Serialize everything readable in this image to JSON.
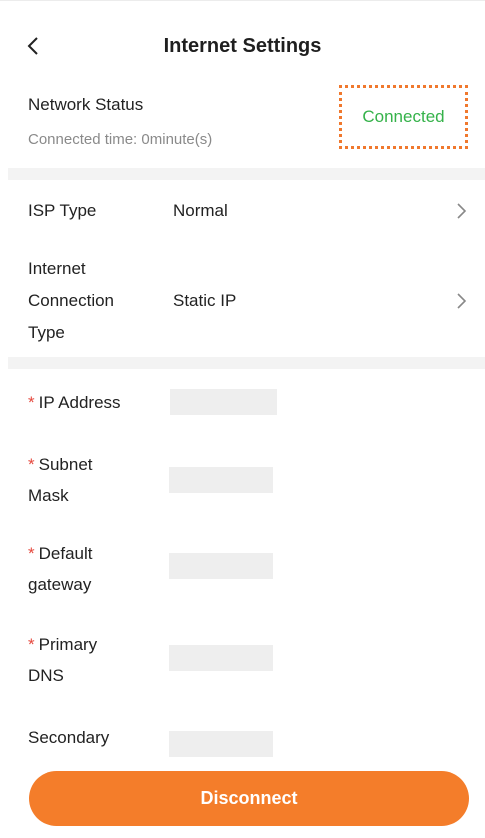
{
  "header": {
    "title": "Internet Settings",
    "back_icon": "chevron-left-icon"
  },
  "network_status": {
    "label": "Network Status",
    "connected_time": "Connected time: 0minute(s)",
    "status": "Connected",
    "status_color": "#35b24a",
    "highlight_color": "#f0782d"
  },
  "isp": {
    "label": "ISP Type",
    "value": "Normal"
  },
  "connection_type": {
    "label_lines": [
      "Internet",
      "Connection",
      "Type"
    ],
    "value": "Static IP"
  },
  "fields": {
    "ip_address": {
      "required_mark": "*",
      "label_lines": [
        "IP Address"
      ],
      "value": ""
    },
    "subnet_mask": {
      "required_mark": "*",
      "label_lines": [
        "Subnet",
        "Mask"
      ],
      "value": ""
    },
    "default_gateway": {
      "required_mark": "*",
      "label_lines": [
        "Default",
        "gateway"
      ],
      "value": ""
    },
    "primary_dns": {
      "required_mark": "*",
      "label_lines": [
        "Primary",
        "DNS"
      ],
      "value": ""
    },
    "secondary_dns": {
      "label_lines": [
        "Secondary"
      ],
      "value": ""
    }
  },
  "disconnect_button": {
    "label": "Disconnect",
    "color": "#f47d2a"
  }
}
